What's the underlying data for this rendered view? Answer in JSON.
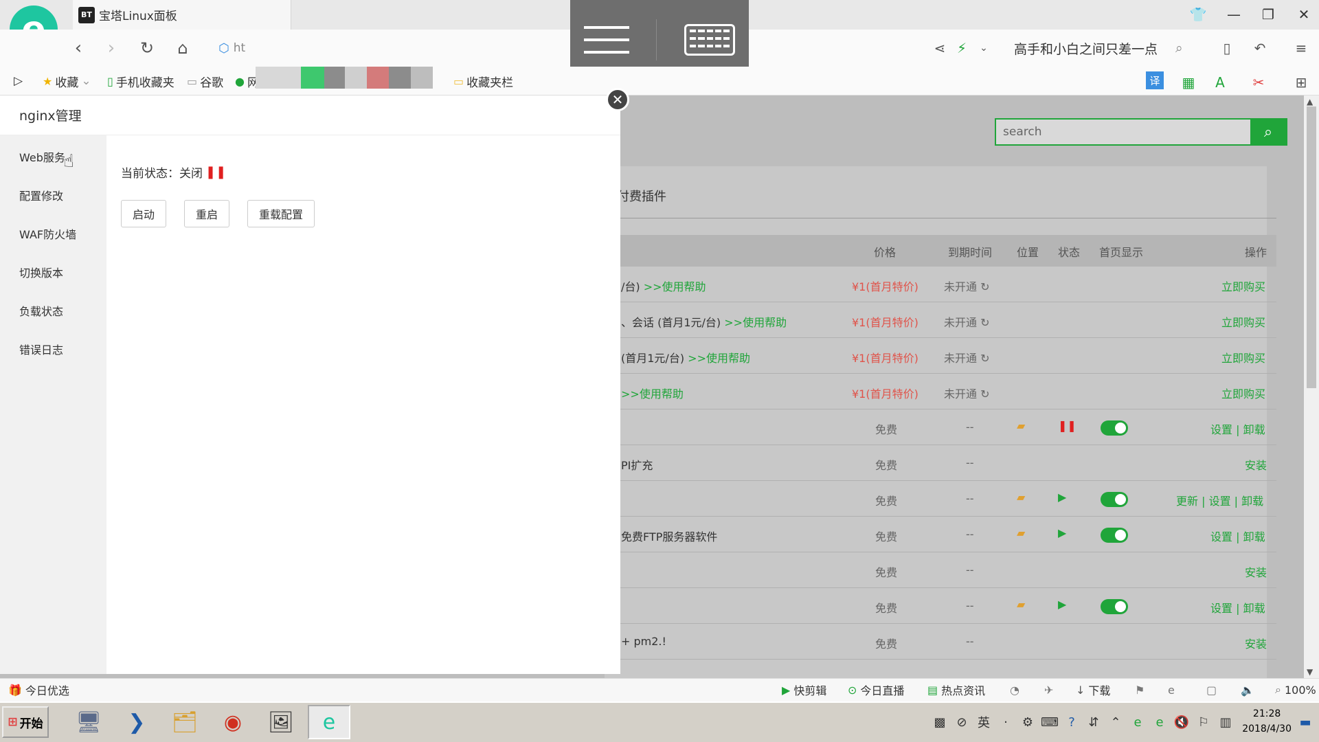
{
  "browser": {
    "tab_title": "宝塔Linux面板",
    "tab_icon": "BT",
    "url_partial": "ht",
    "search_hint": "高手和小白之间只差一点",
    "bookmarks": [
      "收藏",
      "手机收藏夹",
      "谷歌",
      "网址",
      "收藏夹栏"
    ],
    "accent": "#1ec6a0"
  },
  "page": {
    "search_placeholder": "search",
    "section_title": "付费插件",
    "columns": {
      "price": "价格",
      "expire": "到期时间",
      "location": "位置",
      "status": "状态",
      "home": "首页显示",
      "action": "操作"
    },
    "rows": [
      {
        "name": "/台)",
        "help": ">>使用帮助",
        "price": "¥1(首月特价)",
        "expire": "未开通",
        "action": "立即购买"
      },
      {
        "name": "、会话 (首月1元/台)",
        "help": ">>使用帮助",
        "price": "¥1(首月特价)",
        "expire": "未开通",
        "action": "立即购买"
      },
      {
        "name": "(首月1元/台)",
        "help": ">>使用帮助",
        "price": "¥1(首月特价)",
        "expire": "未开通",
        "action": "立即购买"
      },
      {
        "name": "",
        "help": ">>使用帮助",
        "price": "¥1(首月特价)",
        "expire": "未开通",
        "action": "立即购买"
      },
      {
        "name": "",
        "price": "免费",
        "expire": "--",
        "action": "设置 | 卸载"
      },
      {
        "name": "PI扩充",
        "price": "免费",
        "expire": "--",
        "action": "安装"
      },
      {
        "name": "",
        "price": "免费",
        "expire": "--",
        "action": "更新 | 设置 | 卸载"
      },
      {
        "name": "免费FTP服务器软件",
        "price": "免费",
        "expire": "--",
        "action": "设置 | 卸载"
      },
      {
        "name": "",
        "price": "免费",
        "expire": "--",
        "action": "安装"
      },
      {
        "name": "",
        "price": "免费",
        "expire": "--",
        "action": "设置 | 卸载"
      },
      {
        "name": "+ pm2.!",
        "price": "免费",
        "expire": "--",
        "action": "安装"
      }
    ]
  },
  "modal": {
    "title": "nginx管理",
    "menu": [
      "Web服务",
      "配置修改",
      "WAF防火墙",
      "切换版本",
      "负载状态",
      "错误日志"
    ],
    "status_label": "当前状态：关闭",
    "buttons": {
      "start": "启动",
      "restart": "重启",
      "reload": "重载配置"
    }
  },
  "statusbar": {
    "left": "今日优选",
    "items": [
      "快剪辑",
      "今日直播",
      "热点资讯",
      "下载"
    ],
    "zoom": "100%"
  },
  "taskbar": {
    "start": "开始",
    "ime": "英",
    "time": "21:28",
    "date": "2018/4/30"
  }
}
